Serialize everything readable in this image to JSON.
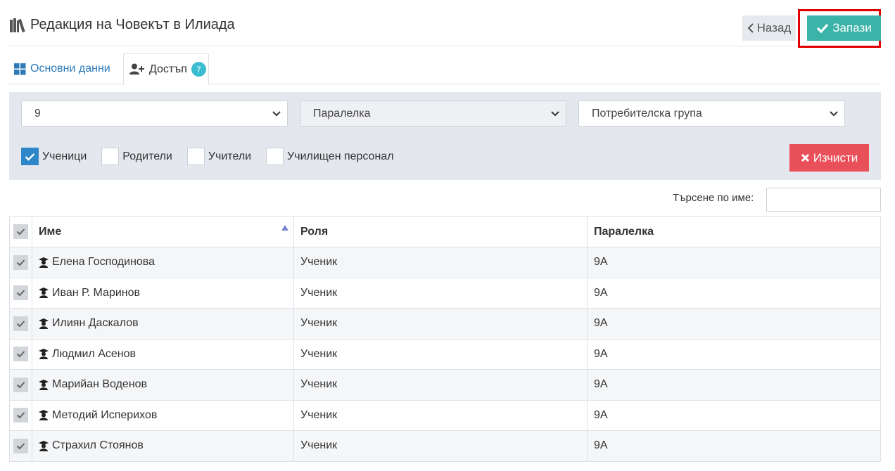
{
  "header": {
    "title": "Редакция на Човекът в Илиада",
    "title_icon": "books-icon",
    "back_label": "Назад",
    "save_label": "Запази"
  },
  "tabs": [
    {
      "label": "Основни данни",
      "icon": "grid-icon"
    },
    {
      "label": "Достъп",
      "icon": "user-plus-icon",
      "badge": "7",
      "active": true
    }
  ],
  "filters": {
    "grade_select": "9",
    "class_select": "Паралелка",
    "group_select": "Потребителска група",
    "checkboxes": [
      {
        "label": "Ученици",
        "checked": true
      },
      {
        "label": "Родители",
        "checked": false
      },
      {
        "label": "Учители",
        "checked": false
      },
      {
        "label": "Училищен персонал",
        "checked": false
      }
    ],
    "clear_label": "Изчисти"
  },
  "search": {
    "label": "Търсене по име:",
    "value": ""
  },
  "table": {
    "columns": [
      "Име",
      "Роля",
      "Паралелка"
    ],
    "rows": [
      {
        "name": "Елена Господинова",
        "role": "Ученик",
        "class": "9А"
      },
      {
        "name": "Иван Р. Маринов",
        "role": "Ученик",
        "class": "9А"
      },
      {
        "name": "Илиян Даскалов",
        "role": "Ученик",
        "class": "9А"
      },
      {
        "name": "Людмил Асенов",
        "role": "Ученик",
        "class": "9А"
      },
      {
        "name": "Марийан Воденов",
        "role": "Ученик",
        "class": "9А"
      },
      {
        "name": "Методий Исперихов",
        "role": "Ученик",
        "class": "9А"
      },
      {
        "name": "Страхил Стоянов",
        "role": "Ученик",
        "class": "9А"
      }
    ]
  },
  "colors": {
    "save": "#3bb3a8",
    "clear": "#e9505a",
    "link": "#2e7ab8",
    "badge": "#3bbcd0",
    "highlight": "#e00000"
  }
}
